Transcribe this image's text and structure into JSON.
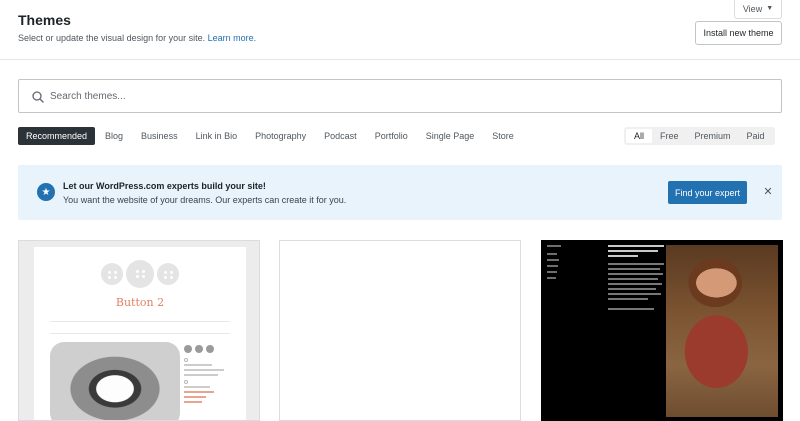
{
  "header": {
    "title": "Themes",
    "subtitle": "Select or update the visual design for your site.",
    "learn_more": "Learn more.",
    "view_label": "View",
    "install_label": "Install new theme"
  },
  "search": {
    "placeholder": "Search themes..."
  },
  "categories": [
    "Recommended",
    "Blog",
    "Business",
    "Link in Bio",
    "Photography",
    "Podcast",
    "Portfolio",
    "Single Page",
    "Store"
  ],
  "active_category": "Recommended",
  "tiers": [
    "All",
    "Free",
    "Premium",
    "Paid"
  ],
  "active_tier": "All",
  "banner": {
    "title": "Let our WordPress.com experts build your site!",
    "subtitle": "You want the website of your dreams. Our experts can create it for you.",
    "cta": "Find your expert"
  },
  "theme_cards": [
    {
      "preview_title": "Button 2"
    },
    {
      "preview_title": ""
    },
    {
      "preview_title": ""
    }
  ],
  "colors": {
    "accent": "#2271b1",
    "dark_tab": "#2c3338",
    "banner_bg": "#e9f3fb",
    "preview_title": "#e08267"
  }
}
